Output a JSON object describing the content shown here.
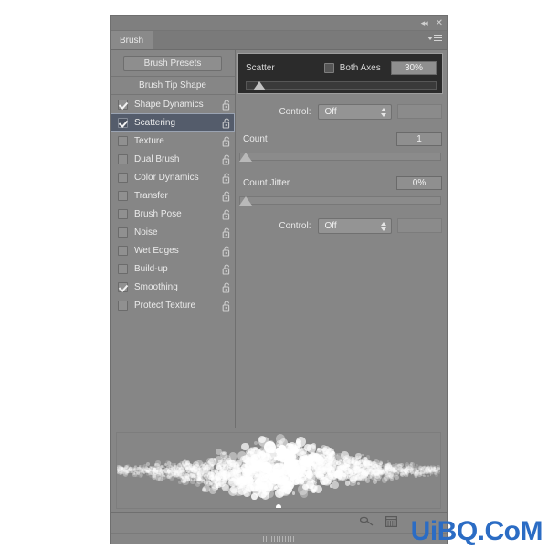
{
  "window": {
    "title": "Brush",
    "collapse_icon": "double-left-chevron-icon",
    "close_icon": "close-icon",
    "menu_icon": "panel-menu-icon"
  },
  "left_panel": {
    "presets_button": "Brush Presets",
    "tip_shape": "Brush Tip Shape",
    "options": [
      {
        "label": "Shape Dynamics",
        "checked": true,
        "selected": false,
        "locked": false
      },
      {
        "label": "Scattering",
        "checked": true,
        "selected": true,
        "locked": false
      },
      {
        "label": "Texture",
        "checked": false,
        "selected": false,
        "locked": false
      },
      {
        "label": "Dual Brush",
        "checked": false,
        "selected": false,
        "locked": false
      },
      {
        "label": "Color Dynamics",
        "checked": false,
        "selected": false,
        "locked": false
      },
      {
        "label": "Transfer",
        "checked": false,
        "selected": false,
        "locked": false
      },
      {
        "label": "Brush Pose",
        "checked": false,
        "selected": false,
        "locked": false
      },
      {
        "label": "Noise",
        "checked": false,
        "selected": false,
        "locked": false
      },
      {
        "label": "Wet Edges",
        "checked": false,
        "selected": false,
        "locked": false
      },
      {
        "label": "Build-up",
        "checked": false,
        "selected": false,
        "locked": false
      },
      {
        "label": "Smoothing",
        "checked": true,
        "selected": false,
        "locked": false
      },
      {
        "label": "Protect Texture",
        "checked": false,
        "selected": false,
        "locked": false
      }
    ]
  },
  "right_panel": {
    "scatter": {
      "label": "Scatter",
      "both_axes_label": "Both Axes",
      "both_axes_checked": false,
      "value": "30%",
      "slider_percent": 4
    },
    "scatter_control": {
      "label": "Control:",
      "value": "Off"
    },
    "count": {
      "label": "Count",
      "value": "1",
      "slider_percent": 0
    },
    "count_jitter": {
      "label": "Count Jitter",
      "value": "0%",
      "slider_percent": 0
    },
    "count_jitter_control": {
      "label": "Control:",
      "value": "Off"
    }
  },
  "bottom_bar": {
    "brush_stroke_icon": "brush-stroke-icon",
    "new_brush_icon": "new-brush-preset-icon"
  },
  "watermark": {
    "text": "UiBQ.CoM",
    "color": "#2b6cc4"
  },
  "colors": {
    "panel_bg": "#868686",
    "dark_band": "#2b2b2b",
    "selection": "#545c6b",
    "text": "#eaeaea"
  }
}
